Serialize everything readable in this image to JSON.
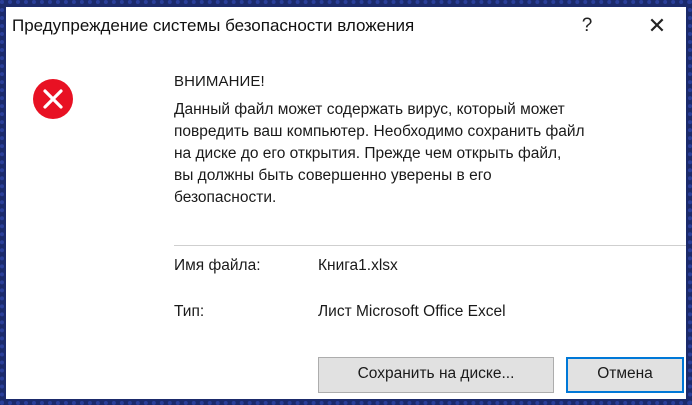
{
  "window": {
    "title": "Предупреждение системы безопасности вложения",
    "help_glyph": "?",
    "close_glyph": "✕"
  },
  "icon": {
    "name": "error-icon",
    "color": "#e81123",
    "glyph": "✕"
  },
  "content": {
    "heading": "ВНИМАНИЕ!",
    "message_lines": [
      "Данный файл может содержать вирус, который может",
      "повредить ваш компьютер. Необходимо сохранить файл",
      "на диске до его открытия. Прежде чем открыть файл,",
      "вы должны быть совершенно уверены в его",
      "безопасности."
    ]
  },
  "details": {
    "filename_label": "Имя файла:",
    "filename_value": "Книга1.xlsx",
    "type_label": "Тип:",
    "type_value": "Лист Microsoft Office Excel"
  },
  "buttons": {
    "save_label": "Сохранить на диске...",
    "cancel_label": "Отмена"
  },
  "colors": {
    "frame": "#1b2a6b",
    "accent": "#0078d7",
    "error": "#e81123"
  }
}
